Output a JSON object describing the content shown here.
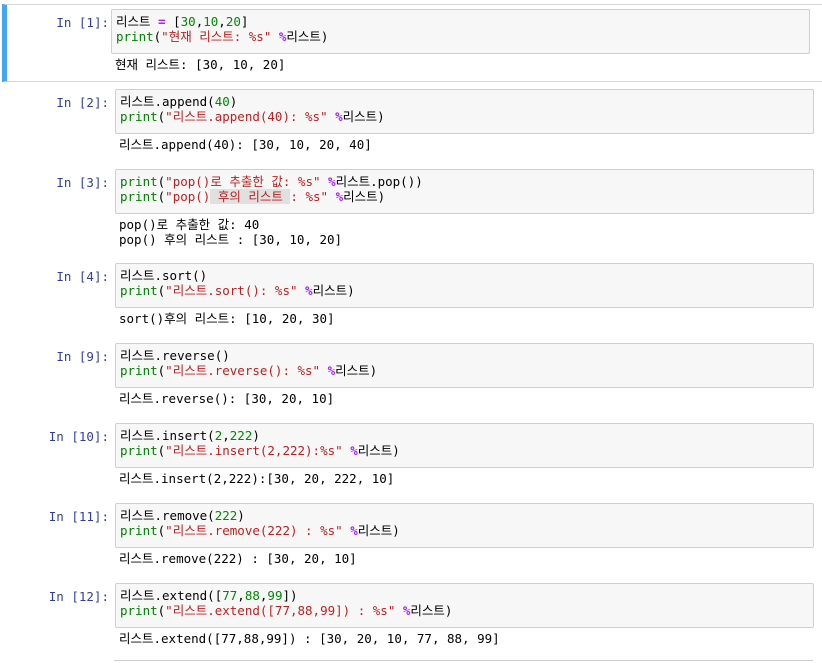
{
  "cells": [
    {
      "prompt": "In [1]:",
      "lines": [
        [
          {
            "t": "리스트 ",
            "c": ""
          },
          {
            "t": "=",
            "c": "k-op"
          },
          {
            "t": " [",
            "c": ""
          },
          {
            "t": "30",
            "c": "k-num"
          },
          {
            "t": ",",
            "c": ""
          },
          {
            "t": "10",
            "c": "k-num"
          },
          {
            "t": ",",
            "c": ""
          },
          {
            "t": "20",
            "c": "k-num"
          },
          {
            "t": "]",
            "c": ""
          }
        ],
        [
          {
            "t": "print",
            "c": "k-fn"
          },
          {
            "t": "(",
            "c": ""
          },
          {
            "t": "\"현재 리스트: %s\"",
            "c": "k-str"
          },
          {
            "t": " ",
            "c": ""
          },
          {
            "t": "%",
            "c": "k-op"
          },
          {
            "t": "리스트)",
            "c": ""
          }
        ]
      ],
      "output": [
        "현재 리스트: [30, 10, 20]"
      ]
    },
    {
      "prompt": "In [2]:",
      "lines": [
        [
          {
            "t": "리스트.append(",
            "c": ""
          },
          {
            "t": "40",
            "c": "k-num"
          },
          {
            "t": ")",
            "c": ""
          }
        ],
        [
          {
            "t": "print",
            "c": "k-fn"
          },
          {
            "t": "(",
            "c": ""
          },
          {
            "t": "\"리스트.append(40): %s\"",
            "c": "k-str"
          },
          {
            "t": " ",
            "c": ""
          },
          {
            "t": "%",
            "c": "k-op"
          },
          {
            "t": "리스트)",
            "c": ""
          }
        ]
      ],
      "output": [
        "리스트.append(40): [30, 10, 20, 40]"
      ]
    },
    {
      "prompt": "In [3]:",
      "lines": [
        [
          {
            "t": "print",
            "c": "k-fn"
          },
          {
            "t": "(",
            "c": ""
          },
          {
            "t": "\"pop()로 추출한 값: %s\"",
            "c": "k-str"
          },
          {
            "t": " ",
            "c": ""
          },
          {
            "t": "%",
            "c": "k-op"
          },
          {
            "t": "리스트.pop())",
            "c": ""
          }
        ],
        [
          {
            "t": "print",
            "c": "k-fn"
          },
          {
            "t": "(",
            "c": ""
          },
          {
            "t": "\"pop()",
            "c": "k-str"
          },
          {
            "t": " 후의 리스트 ",
            "c": "k-str k-hl"
          },
          {
            "t": ": %s\"",
            "c": "k-str"
          },
          {
            "t": " ",
            "c": ""
          },
          {
            "t": "%",
            "c": "k-op"
          },
          {
            "t": "리스트)",
            "c": ""
          }
        ]
      ],
      "output": [
        "pop()로 추출한 값: 40",
        "pop() 후의 리스트 : [30, 10, 20]"
      ]
    },
    {
      "prompt": "In [4]:",
      "lines": [
        [
          {
            "t": "리스트.sort()",
            "c": ""
          }
        ],
        [
          {
            "t": "print",
            "c": "k-fn"
          },
          {
            "t": "(",
            "c": ""
          },
          {
            "t": "\"리스트.sort(): %s\"",
            "c": "k-str"
          },
          {
            "t": " ",
            "c": ""
          },
          {
            "t": "%",
            "c": "k-op"
          },
          {
            "t": "리스트)",
            "c": ""
          }
        ]
      ],
      "output": [
        "sort()후의 리스트: [10, 20, 30]"
      ]
    },
    {
      "prompt": "In [9]:",
      "lines": [
        [
          {
            "t": "리스트.reverse()",
            "c": ""
          }
        ],
        [
          {
            "t": "print",
            "c": "k-fn"
          },
          {
            "t": "(",
            "c": ""
          },
          {
            "t": "\"리스트.reverse(): %s\"",
            "c": "k-str"
          },
          {
            "t": " ",
            "c": ""
          },
          {
            "t": "%",
            "c": "k-op"
          },
          {
            "t": "리스트)",
            "c": ""
          }
        ]
      ],
      "output": [
        "리스트.reverse(): [30, 20, 10]"
      ]
    },
    {
      "prompt": "In [10]:",
      "lines": [
        [
          {
            "t": "리스트.insert(",
            "c": ""
          },
          {
            "t": "2",
            "c": "k-num"
          },
          {
            "t": ",",
            "c": ""
          },
          {
            "t": "222",
            "c": "k-num"
          },
          {
            "t": ")",
            "c": ""
          }
        ],
        [
          {
            "t": "print",
            "c": "k-fn"
          },
          {
            "t": "(",
            "c": ""
          },
          {
            "t": "\"리스트.insert(2,222):%s\"",
            "c": "k-str"
          },
          {
            "t": " ",
            "c": ""
          },
          {
            "t": "%",
            "c": "k-op"
          },
          {
            "t": "리스트)",
            "c": ""
          }
        ]
      ],
      "output": [
        "리스트.insert(2,222):[30, 20, 222, 10]"
      ]
    },
    {
      "prompt": "In [11]:",
      "lines": [
        [
          {
            "t": "리스트.remove(",
            "c": ""
          },
          {
            "t": "222",
            "c": "k-num"
          },
          {
            "t": ")",
            "c": ""
          }
        ],
        [
          {
            "t": "print",
            "c": "k-fn"
          },
          {
            "t": "(",
            "c": ""
          },
          {
            "t": "\"리스트.remove(222) : %s\"",
            "c": "k-str"
          },
          {
            "t": " ",
            "c": ""
          },
          {
            "t": "%",
            "c": "k-op"
          },
          {
            "t": "리스트)",
            "c": ""
          }
        ]
      ],
      "output": [
        "리스트.remove(222) : [30, 20, 10]"
      ]
    },
    {
      "prompt": "In [12]:",
      "lines": [
        [
          {
            "t": "리스트.extend([",
            "c": ""
          },
          {
            "t": "77",
            "c": "k-num"
          },
          {
            "t": ",",
            "c": ""
          },
          {
            "t": "88",
            "c": "k-num"
          },
          {
            "t": ",",
            "c": ""
          },
          {
            "t": "99",
            "c": "k-num"
          },
          {
            "t": "])",
            "c": ""
          }
        ],
        [
          {
            "t": "print",
            "c": "k-fn"
          },
          {
            "t": "(",
            "c": ""
          },
          {
            "t": "\"리스트.extend([77,88,99]) : %s\"",
            "c": "k-str"
          },
          {
            "t": " ",
            "c": ""
          },
          {
            "t": "%",
            "c": "k-op"
          },
          {
            "t": "리스트)",
            "c": ""
          }
        ]
      ],
      "output": [
        "리스트.extend([77,88,99]) : [30, 20, 10, 77, 88, 99]"
      ]
    }
  ],
  "colors": {
    "prompt": "#303f9f",
    "selected_border": "#42a5f5",
    "string": "#ba2121",
    "number": "#008800",
    "keyword": "#008000",
    "operator": "#aa22ff"
  }
}
